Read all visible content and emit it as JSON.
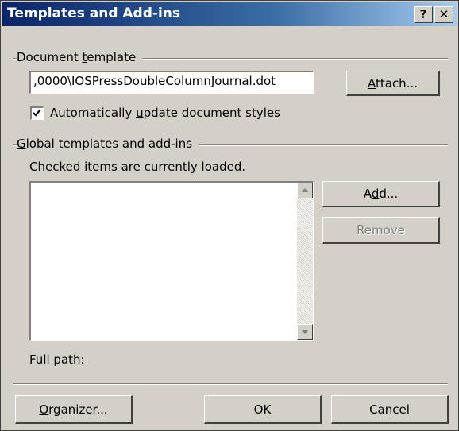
{
  "dialog": {
    "title": "Templates and Add-ins",
    "help_button": "?",
    "close_button": "✕"
  },
  "document_template": {
    "group_label_pre": "Document ",
    "group_label_accel": "t",
    "group_label_post": "emplate",
    "path_value": ",0000\\IOSPressDoubleColumnJournal.dot",
    "attach_accel": "A",
    "attach_rest": "ttach...",
    "auto_update_pre": "Automatically ",
    "auto_update_accel": "u",
    "auto_update_post": "pdate document styles",
    "auto_update_checked": true
  },
  "global_templates": {
    "group_label_accel": "G",
    "group_label_rest": "lobal templates and add-ins",
    "hint": "Checked items are currently loaded.",
    "items": [],
    "add_pre": "A",
    "add_accel": "d",
    "add_post": "d...",
    "remove_label": "Remove",
    "full_path_label": "Full path:"
  },
  "footer": {
    "organizer_accel": "O",
    "organizer_rest": "rganizer...",
    "ok_label": "OK",
    "cancel_label": "Cancel"
  },
  "colors": {
    "face": "#d4d0c8",
    "title_bar": "#0a246a",
    "disabled_text": "#808080"
  }
}
